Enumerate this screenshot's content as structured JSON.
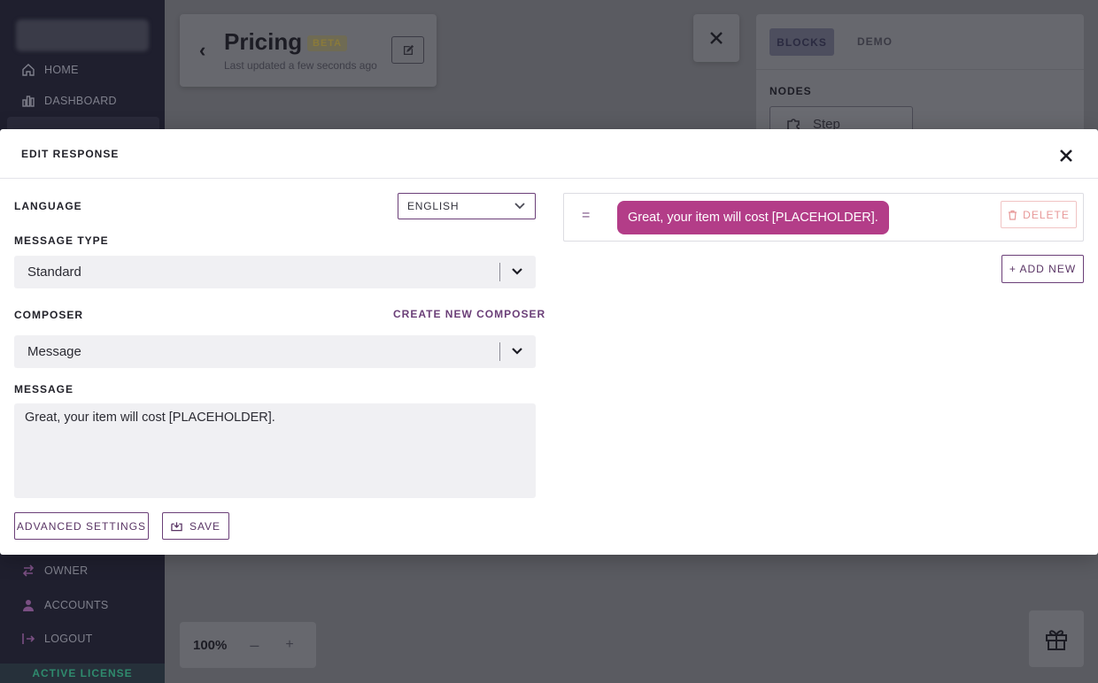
{
  "sidebar": {
    "items": [
      {
        "label": "HOME",
        "icon": "home-icon"
      },
      {
        "label": "DASHBOARD",
        "icon": "dashboard-icon"
      },
      {
        "label": "OWNER",
        "icon": "transfer-icon"
      },
      {
        "label": "ACCOUNTS",
        "icon": "user-icon"
      },
      {
        "label": "LOGOUT",
        "icon": "logout-icon"
      }
    ],
    "license": "ACTIVE LICENSE"
  },
  "header": {
    "title": "Pricing",
    "badge": "BETA",
    "updated": "Last updated a few seconds ago"
  },
  "right_panel": {
    "tabs": [
      "BLOCKS",
      "DEMO"
    ],
    "nodes_label": "NODES",
    "node_step": "Step"
  },
  "zoom": {
    "level": "100%",
    "minus": "–",
    "plus": "+"
  },
  "modal": {
    "title": "EDIT RESPONSE",
    "language": {
      "label": "LANGUAGE",
      "value": "ENGLISH"
    },
    "message_type": {
      "label": "MESSAGE TYPE",
      "value": "Standard"
    },
    "composer": {
      "label": "COMPOSER",
      "value": "Message",
      "create_link": "CREATE NEW COMPOSER"
    },
    "message": {
      "label": "MESSAGE",
      "value": "Great, your item will cost [PLACEHOLDER]."
    },
    "buttons": {
      "advanced": "ADVANCED SETTINGS",
      "save": "SAVE"
    },
    "responses": [
      {
        "text": "Great, your item will cost [PLACEHOLDER]."
      }
    ],
    "delete_label": "DELETE",
    "add_new_label": "+ ADD NEW"
  },
  "colors": {
    "accent": "#6b3f78",
    "bubble": "#b33d88",
    "danger_soft": "#e79898"
  }
}
